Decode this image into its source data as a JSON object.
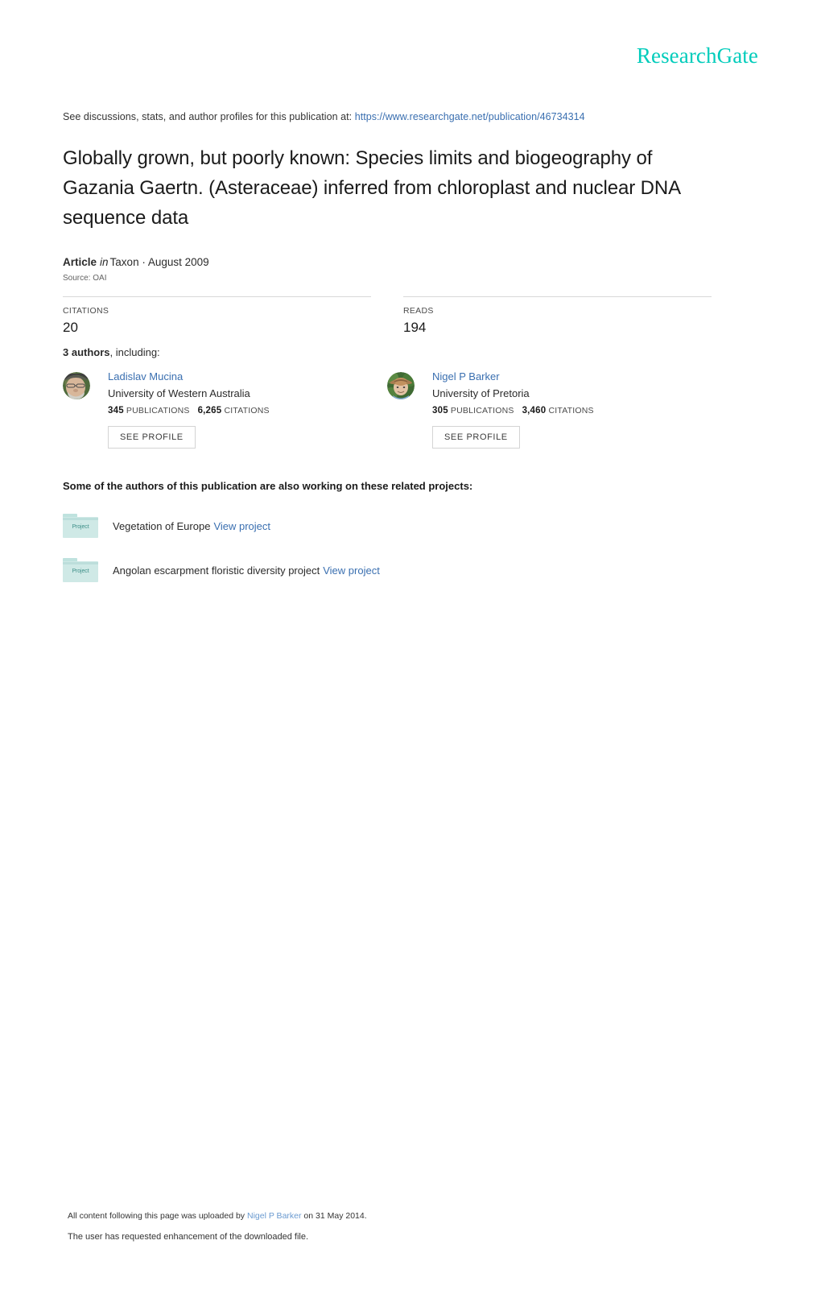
{
  "brand": {
    "logo_text": "ResearchGate",
    "logo_color": "#00ccbb"
  },
  "discussion": {
    "prefix": "See discussions, stats, and author profiles for this publication at:",
    "url": "https://www.researchgate.net/publication/46734314",
    "link_color": "#3a6fb0"
  },
  "publication": {
    "title": "Globally grown, but poorly known: Species limits and biogeography of Gazania Gaertn. (Asteraceae) inferred from chloroplast and nuclear DNA sequence data",
    "type": "Article",
    "in_word": "in",
    "venue": "Taxon · August 2009",
    "source": "Source: OAI"
  },
  "stats": [
    {
      "label": "CITATIONS",
      "value": "20"
    },
    {
      "label": "READS",
      "value": "194"
    }
  ],
  "authors_section": {
    "count_label": "3 authors",
    "including_label": ", including:",
    "authors": [
      {
        "name": "Ladislav Mucina",
        "affiliation": "University of Western Australia",
        "publications_count": "345",
        "publications_label": "PUBLICATIONS",
        "citations_count": "6,265",
        "citations_label": "CITATIONS",
        "see_profile_label": "SEE PROFILE"
      },
      {
        "name": "Nigel P Barker",
        "affiliation": "University of Pretoria",
        "publications_count": "305",
        "publications_label": "PUBLICATIONS",
        "citations_count": "3,460",
        "citations_label": "CITATIONS",
        "see_profile_label": "SEE PROFILE"
      }
    ]
  },
  "projects_section": {
    "heading": "Some of the authors of this publication are also working on these related projects:",
    "icon_label": "Project",
    "projects": [
      {
        "name": "Vegetation of Europe",
        "view_label": "View project"
      },
      {
        "name": "Angolan escarpment floristic diversity project",
        "view_label": "View project"
      }
    ]
  },
  "footer": {
    "upload_prefix": "All content following this page was uploaded by",
    "uploader": "Nigel P Barker",
    "upload_suffix": "on 31 May 2014.",
    "enhancement_note": "The user has requested enhancement of the downloaded file."
  }
}
